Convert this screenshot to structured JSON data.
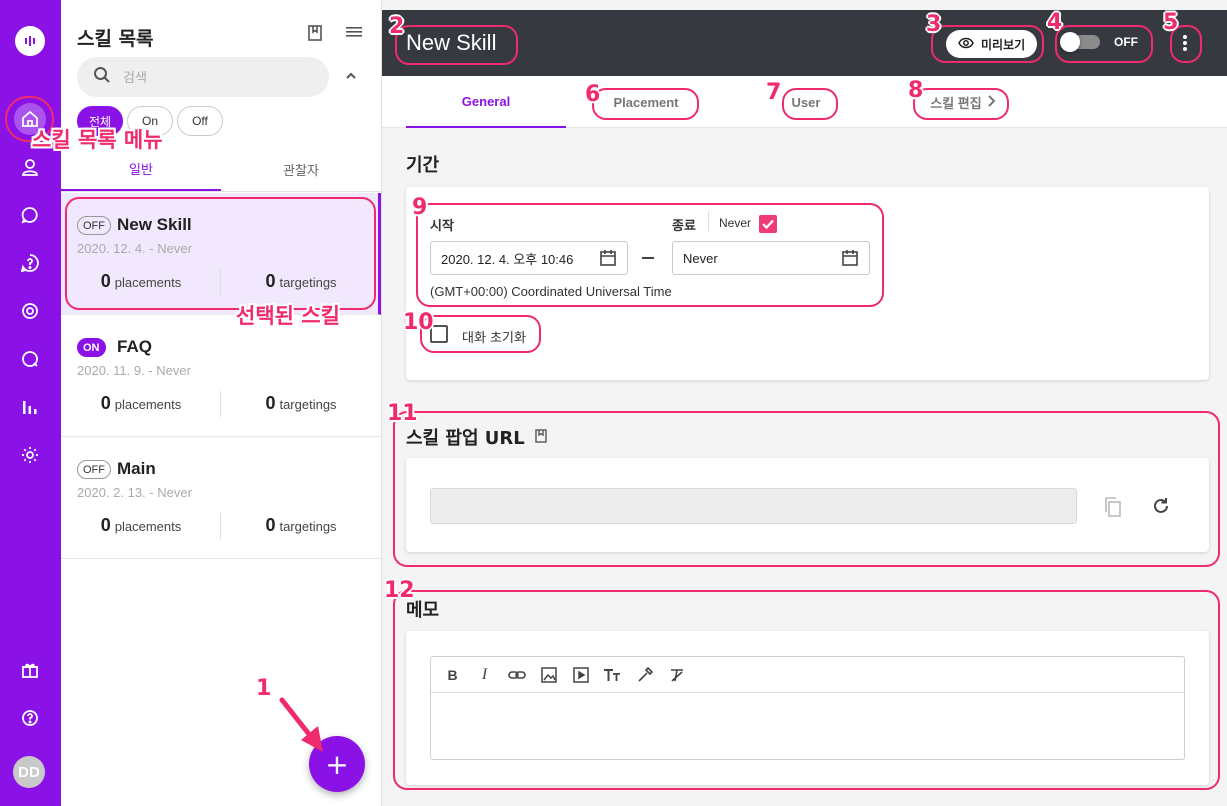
{
  "colors": {
    "brand": "#8a12e6",
    "annotation": "#ef2a6d",
    "topbar": "#36393f"
  },
  "rail": {
    "icons": [
      "logo-icon",
      "home-icon",
      "user-icon",
      "chat-icon",
      "help-icon",
      "target-icon",
      "message-icon",
      "bar-chart-icon",
      "gear-icon",
      "gift-icon",
      "help-circle-icon"
    ],
    "avatar": "DD"
  },
  "list_panel": {
    "title": "스킬 목록",
    "search_placeholder": "검색",
    "filters": [
      "전체",
      "On",
      "Off"
    ],
    "tabs": [
      "일반",
      "관찰자"
    ],
    "skills": [
      {
        "status": "OFF",
        "name": "New Skill",
        "date": "2020. 12. 4. - Never",
        "placements": "0",
        "placements_label": "placements",
        "targetings": "0",
        "targetings_label": "targetings"
      },
      {
        "status": "ON",
        "name": "FAQ",
        "date": "2020. 11. 9. - Never",
        "placements": "0",
        "placements_label": "placements",
        "targetings": "0",
        "targetings_label": "targetings"
      },
      {
        "status": "OFF",
        "name": "Main",
        "date": "2020. 2. 13. - Never",
        "placements": "0",
        "placements_label": "placements",
        "targetings": "0",
        "targetings_label": "targetings"
      }
    ],
    "fab_label": "+"
  },
  "header": {
    "title": "New Skill",
    "preview_label": "미리보기",
    "toggle_label": "OFF"
  },
  "main_tabs": [
    "General",
    "Placement",
    "User",
    "스킬 편집"
  ],
  "period": {
    "title": "기간",
    "start_label": "시작",
    "start_value": "2020. 12. 4. 오후 10:46",
    "end_label": "종료",
    "never_label": "Never",
    "never_checked": true,
    "end_value": "Never",
    "timezone": "(GMT+00:00) Coordinated Universal Time",
    "reset_label": "대화 초기화",
    "reset_checked": false
  },
  "popup_url": {
    "title": "스킬 팝업 URL",
    "value": ""
  },
  "memo": {
    "title": "메모",
    "toolbar": [
      "bold-icon",
      "italic-icon",
      "link-icon",
      "image-icon",
      "video-icon",
      "text-size-icon",
      "color-picker-icon",
      "clear-format-icon"
    ],
    "content": ""
  },
  "annotations": {
    "numbers": [
      "1",
      "2",
      "3",
      "4",
      "5",
      "6",
      "7",
      "8",
      "9",
      "10",
      "11",
      "12"
    ],
    "menu_label": "스킬 목록 메뉴",
    "selected_label": "선택된 스킬"
  }
}
